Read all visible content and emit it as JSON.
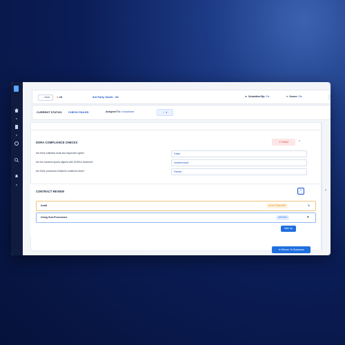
{
  "header": {
    "back_label": "← Back",
    "id_prefix": "●",
    "id_value": "#8",
    "title": "3rd Party SAAS - 08",
    "submitted_label": "Submitted By:",
    "submitted_value": "Ele",
    "owner_label": "Owner:",
    "owner_value": "Ele",
    "menu_icon": "≡"
  },
  "status": {
    "current_label": "CURRENT STATUS:",
    "current_value": "CHECK FAILED",
    "assigned_label": "Assigned To:",
    "assigned_value": "Compliance",
    "select_value": "··· ▾"
  },
  "dora": {
    "title": "DORA COMPLIANCE CHECKS",
    "badge": "✕  Failed",
    "questions": [
      {
        "q": "Are there sufficient audit and inspection rights?",
        "a": "Failed"
      },
      {
        "q": "Are the incident reports aligned with DORA's timelines?",
        "a": "Undetermined"
      },
      {
        "q": "Are there provisions related to resilience tests?",
        "a": "Passed"
      }
    ]
  },
  "contract": {
    "title": "CONTRACT REVIEW",
    "rows": [
      {
        "label": "Audit",
        "tag": "NON-STANDARD",
        "tag_color": "#f0a23a",
        "end": "↘"
      },
      {
        "label": "Using Sub-Processors",
        "tag": "MISSING",
        "tag_color": "#2f7be8",
        "end": "▾"
      }
    ],
    "mark_up_label": "Mark Up"
  },
  "footer": {
    "return_label": "➜ Return To Business"
  },
  "colors": {
    "accent": "#1f6fe0",
    "failed": "#d64545",
    "nonstandard": "#f0a23a"
  }
}
